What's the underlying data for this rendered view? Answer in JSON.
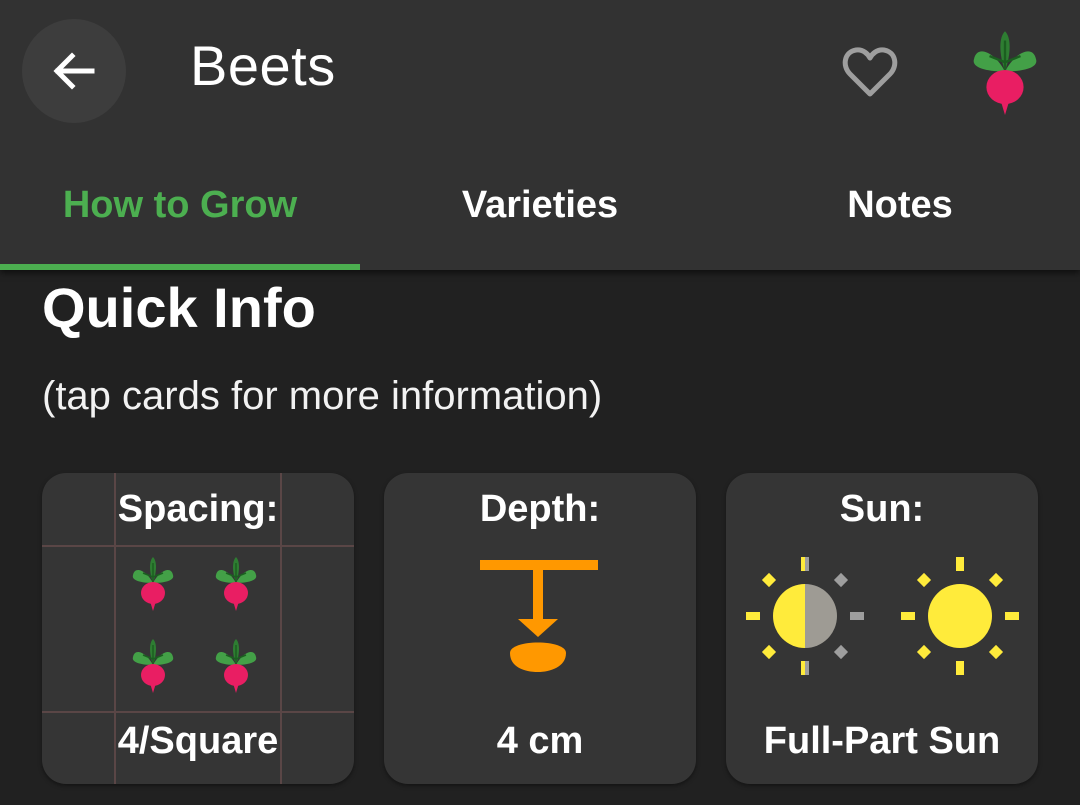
{
  "header": {
    "title": "Beets",
    "back_icon": "arrow-left-icon",
    "favorite_icon": "heart-outline-icon",
    "plant_icon": "beet-icon"
  },
  "tabs": [
    {
      "label": "How to Grow",
      "active": true
    },
    {
      "label": "Varieties",
      "active": false
    },
    {
      "label": "Notes",
      "active": false
    }
  ],
  "colors": {
    "accent": "#4caf50",
    "appbar": "#323232",
    "background": "#212121",
    "card": "#353535",
    "depth_icon": "#ff9800",
    "sun": "#ffeb3b"
  },
  "quick_info": {
    "title": "Quick Info",
    "hint": "(tap cards for more information)",
    "cards": [
      {
        "label": "Spacing:",
        "value": "4/Square",
        "icon": "beet-grid-icon"
      },
      {
        "label": "Depth:",
        "value": "4 cm",
        "icon": "seed-depth-icon"
      },
      {
        "label": "Sun:",
        "value": "Full-Part Sun",
        "icon": "sun-icon"
      }
    ]
  }
}
